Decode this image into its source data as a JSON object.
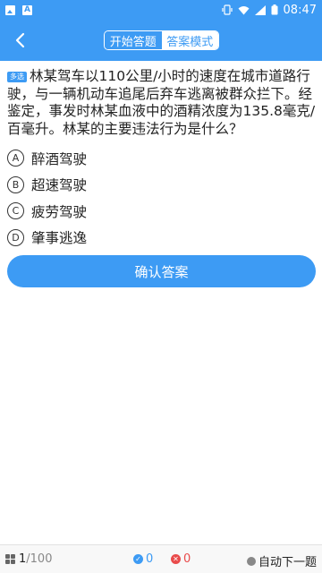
{
  "status_bar": {
    "time": "08:47"
  },
  "header": {
    "back_label": "<",
    "tabs": [
      {
        "label": "开始答题",
        "active": false
      },
      {
        "label": "答案模式",
        "active": true
      }
    ]
  },
  "question": {
    "type_badge": "多选",
    "text": "林某驾车以110公里/小时的速度在城市道路行驶，与一辆机动车追尾后弃车逃离被群众拦下。经鉴定，事发时林某血液中的酒精浓度为135.8毫克/百毫升。林某的主要违法行为是什么？"
  },
  "options": [
    {
      "letter": "A",
      "text": "醉酒驾驶"
    },
    {
      "letter": "B",
      "text": "超速驾驶"
    },
    {
      "letter": "C",
      "text": "疲劳驾驶"
    },
    {
      "letter": "D",
      "text": "肇事逃逸"
    }
  ],
  "confirm_button": "确认答案",
  "footer": {
    "current": "1",
    "total": "/100",
    "correct_count": "0",
    "wrong_count": "0",
    "auto_next_label": "自动下一题"
  },
  "colors": {
    "primary": "#3d9bf4",
    "wrong": "#e94b4b"
  }
}
